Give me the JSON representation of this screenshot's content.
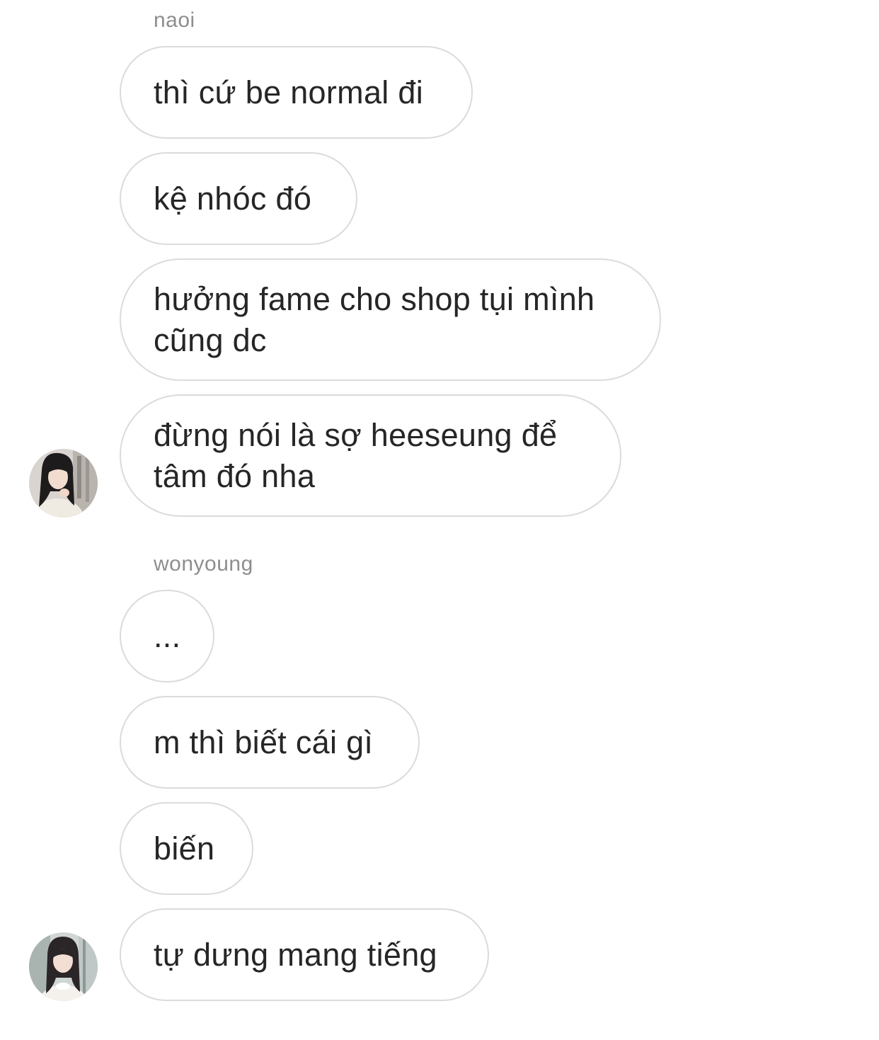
{
  "thread": {
    "groups": [
      {
        "sender": "naoi",
        "messages": [
          "thì cứ be normal đi",
          "kệ nhóc đó",
          "hưởng fame cho shop tụi mình\ncũng dc",
          "đừng nói là sợ heeseung để\ntâm đó nha"
        ],
        "avatar": "profile-photo"
      },
      {
        "sender": "wonyoung",
        "messages": [
          "...",
          "m thì biết cái gì",
          "biến",
          "tự dưng mang tiếng"
        ],
        "avatar": "profile-photo"
      }
    ]
  },
  "colors": {
    "background": "#ffffff",
    "bubble_border": "#dbdbdb",
    "text": "#262626",
    "sender_label": "#8e8e8e"
  }
}
